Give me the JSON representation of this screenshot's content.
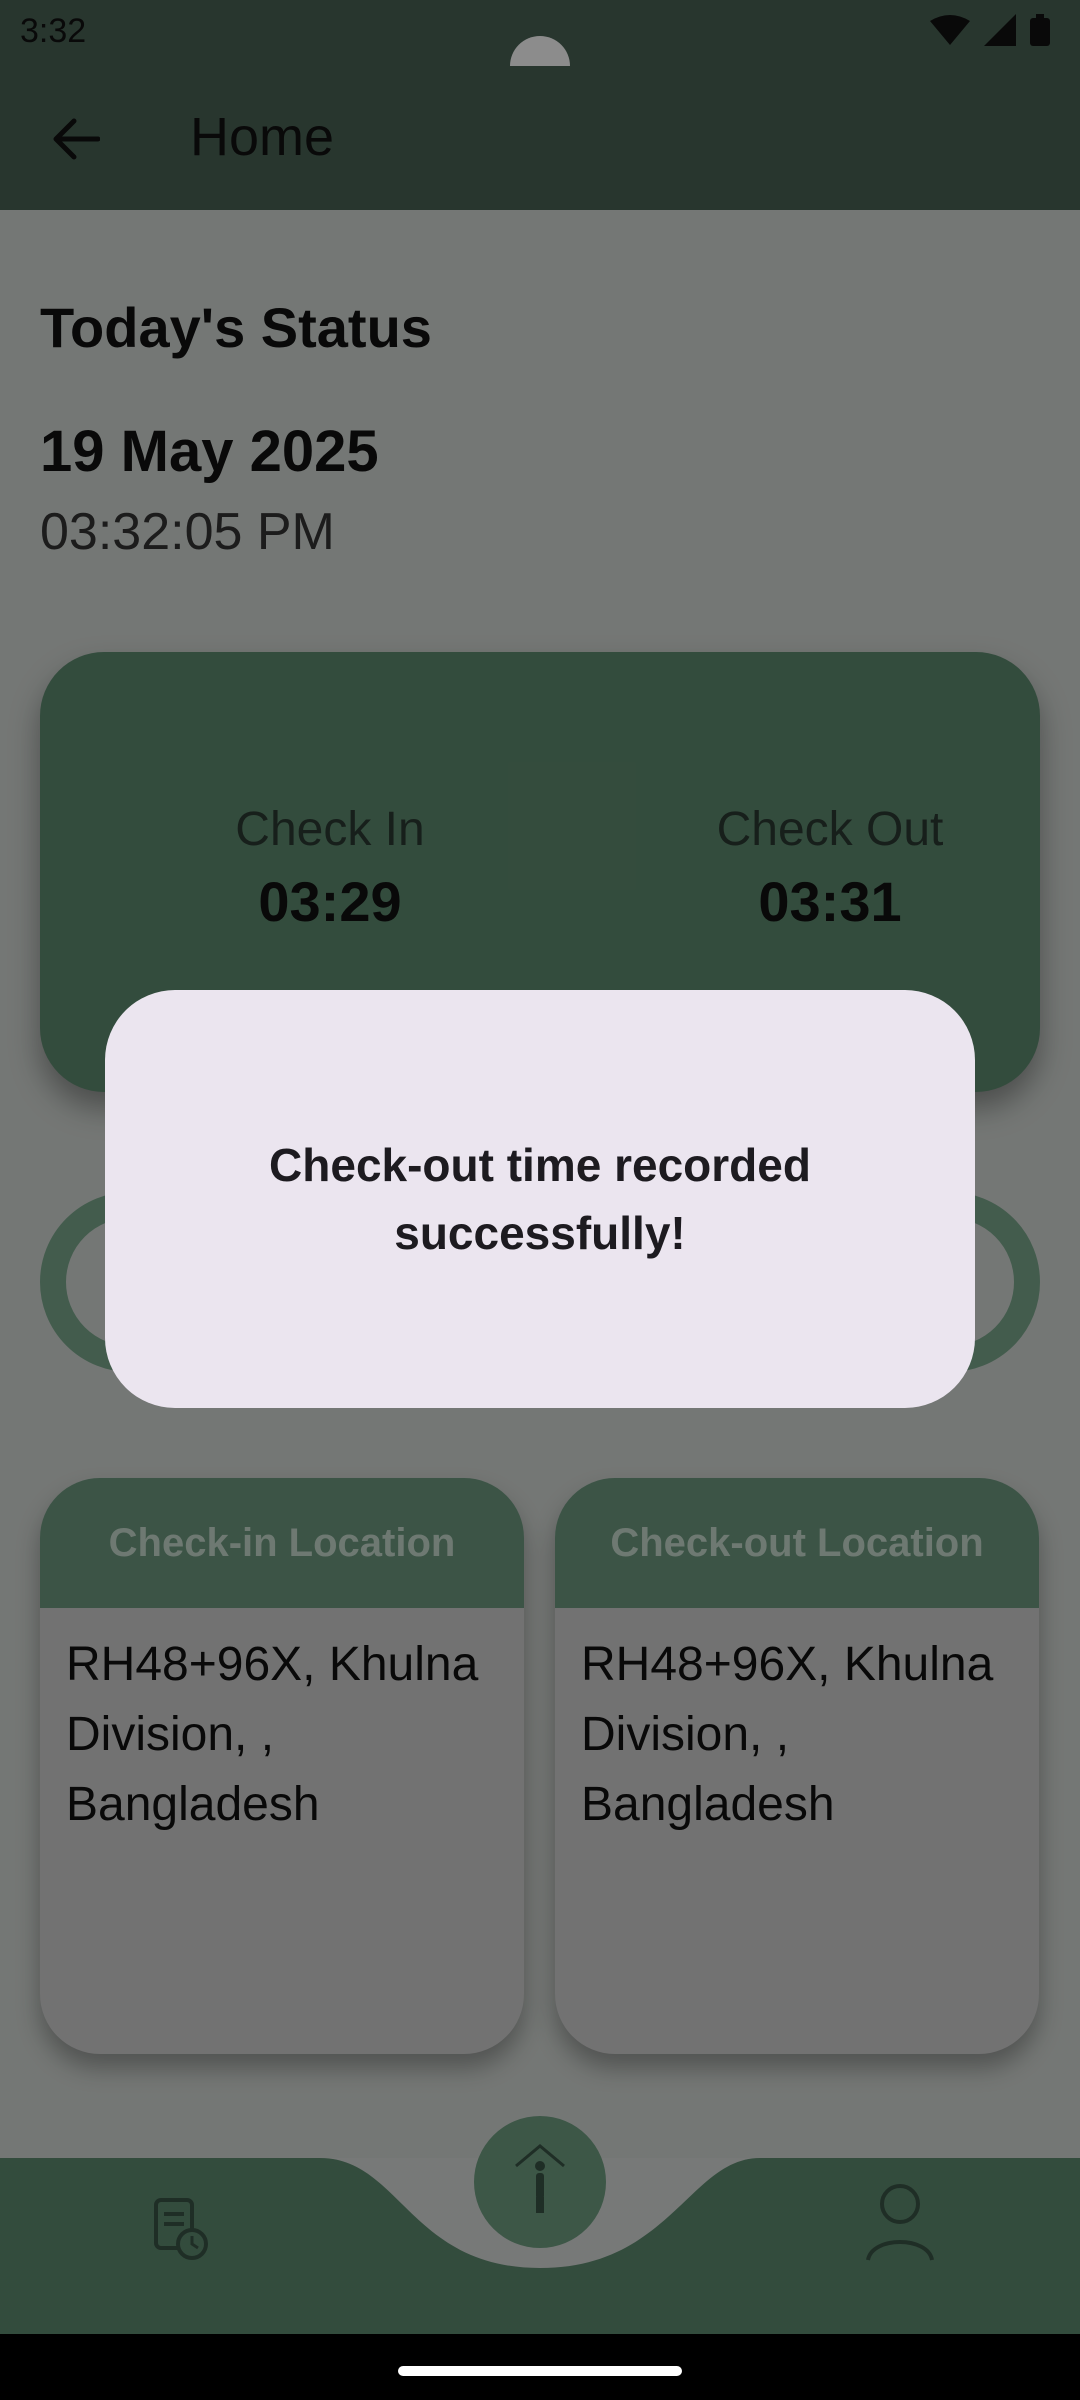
{
  "status_bar": {
    "time": "3:32"
  },
  "app_bar": {
    "title": "Home"
  },
  "header": {
    "title": "Today's Status",
    "date": "19 May 2025",
    "clock": "03:32:05 PM"
  },
  "times_card": {
    "check_in": {
      "label": "Check In",
      "value": "03:29"
    },
    "check_out": {
      "label": "Check Out",
      "value": "03:31"
    }
  },
  "locations": [
    {
      "title": "Check-in Location",
      "address": "RH48+96X, Khulna Division, , Bangladesh"
    },
    {
      "title": "Check-out Location",
      "address": "RH48+96X, Khulna Division, , Bangladesh"
    }
  ],
  "dialog": {
    "message": "Check-out time recorded successfully!"
  },
  "bottom_nav": {
    "left_icon": "attendance-history-icon",
    "center_icon": "walking-person-icon",
    "right_icon": "profile-icon"
  },
  "colors": {
    "brand_green": "#4a6355",
    "accent_green": "#6f9e82",
    "dialog_bg": "#ebe5ef"
  }
}
